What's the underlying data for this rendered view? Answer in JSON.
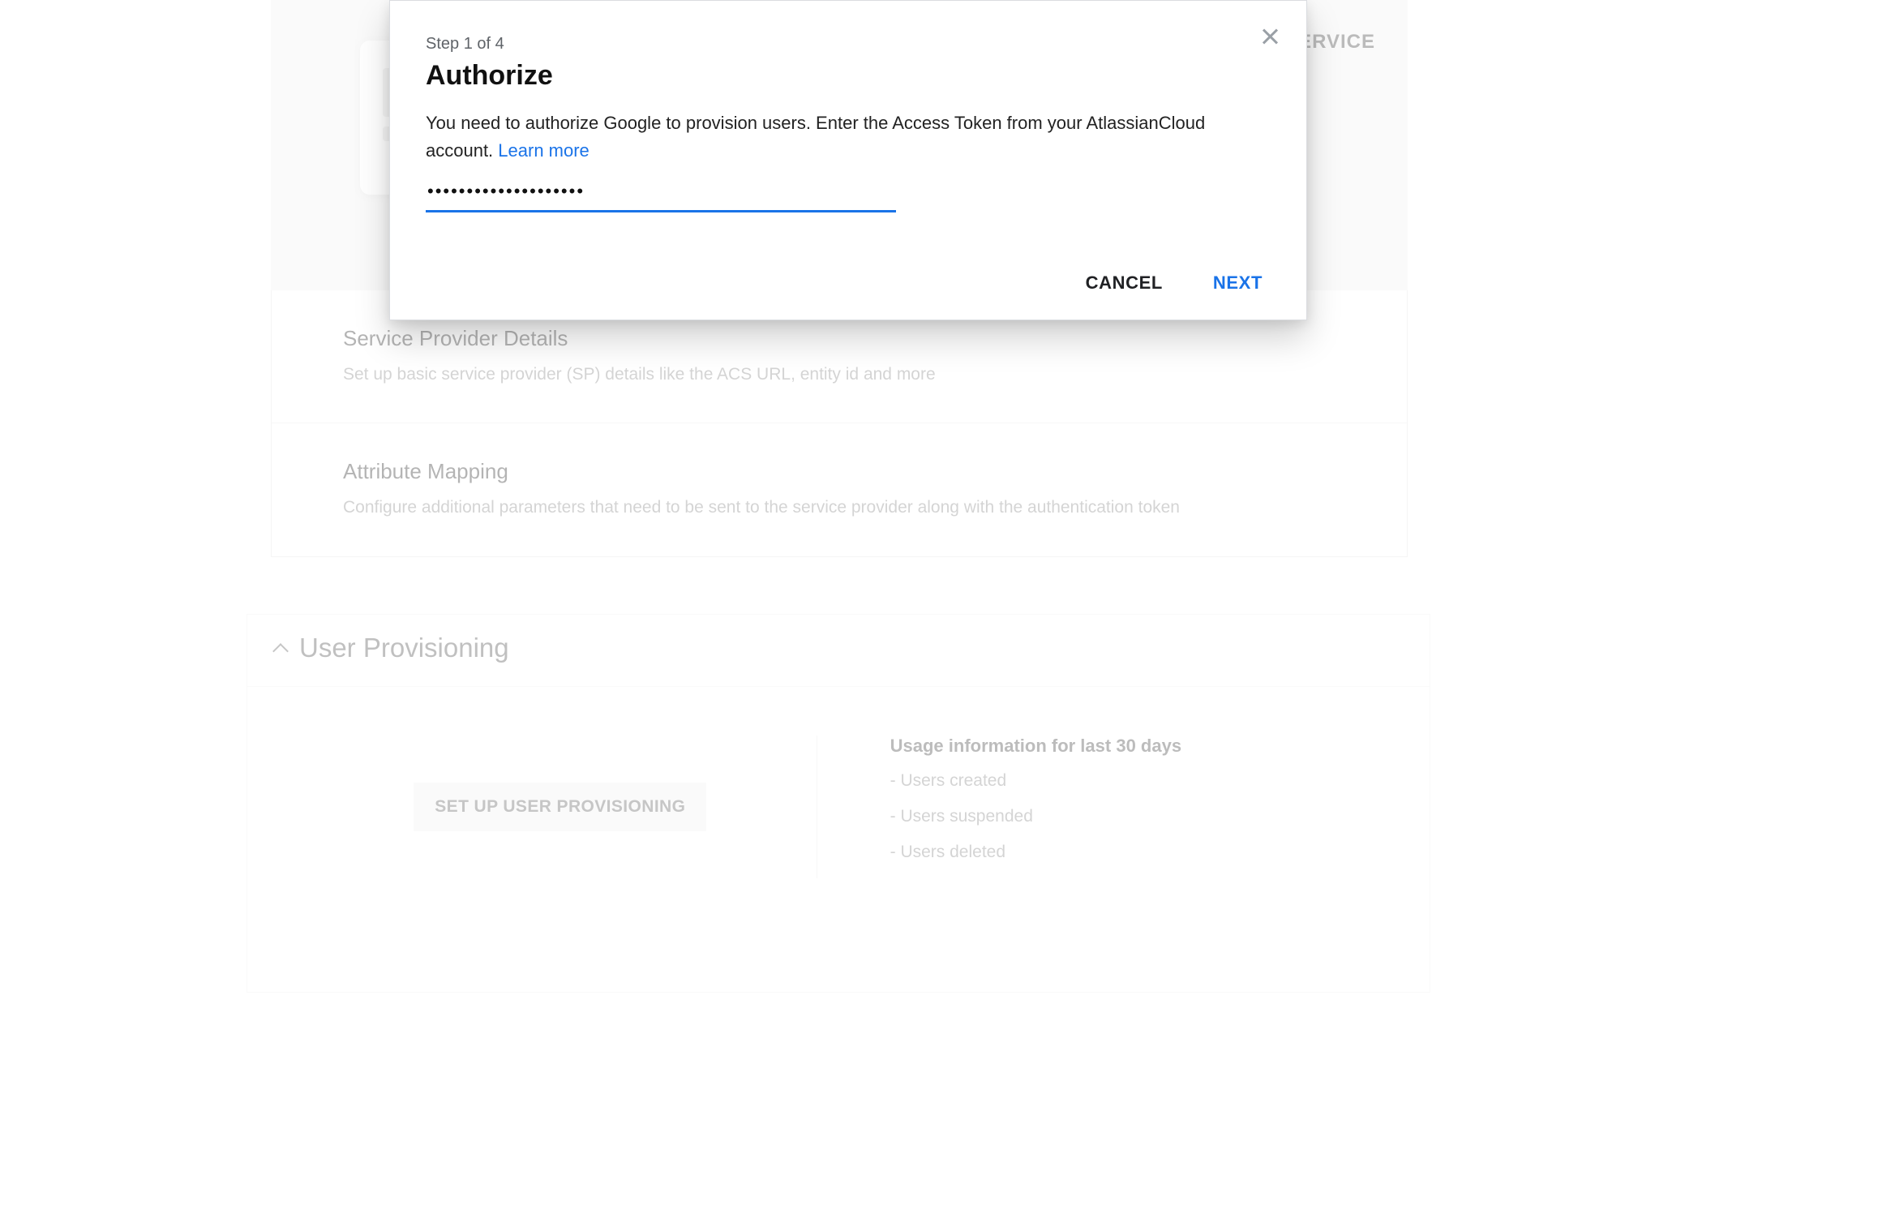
{
  "hero": {
    "right_label": "SERVICE"
  },
  "sections": {
    "provider": {
      "title": "Service Provider Details",
      "desc": "Set up basic service provider (SP) details like the ACS URL, entity id and more"
    },
    "mapping": {
      "title": "Attribute Mapping",
      "desc": "Configure additional parameters that need to be sent to the service provider along with the authentication token"
    }
  },
  "provisioning": {
    "header": "User Provisioning",
    "setup_button": "SET UP USER PROVISIONING",
    "usage_title": "Usage information for last 30 days",
    "usage_items": [
      "- Users created",
      "- Users suspended",
      "- Users deleted"
    ]
  },
  "modal": {
    "step": "Step 1 of 4",
    "title": "Authorize",
    "desc_prefix": "You need to authorize Google to provision users. Enter the Access Token from your AtlassianCloud account. ",
    "learn_more": "Learn more",
    "token_value": "••••••••••••••••••••",
    "cancel": "CANCEL",
    "next": "NEXT"
  }
}
